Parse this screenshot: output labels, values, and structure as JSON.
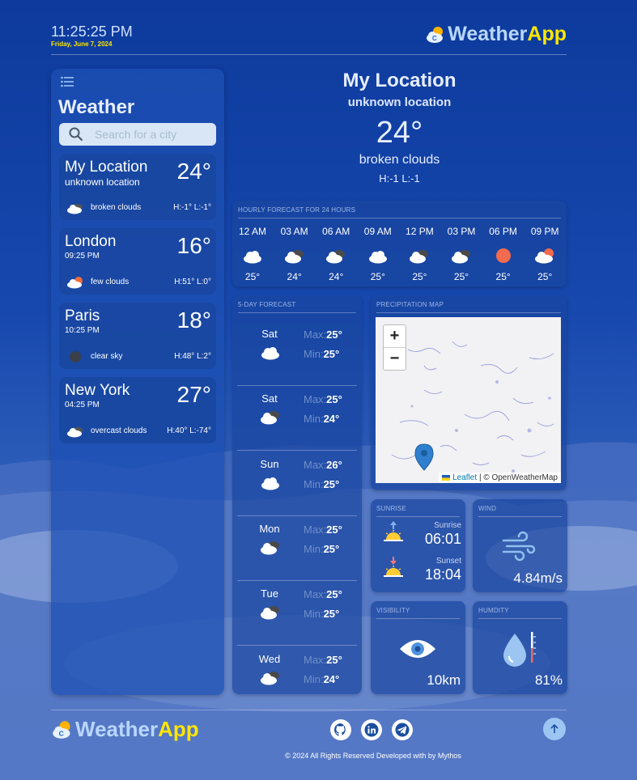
{
  "header": {
    "time": "11:25:25 PM",
    "date": "Friday, June 7, 2024",
    "logo_part1": "Weather",
    "logo_part2": "App"
  },
  "sidebar": {
    "title": "Weather",
    "search_placeholder": "Search for a city",
    "cities": [
      {
        "name": "My Location",
        "sub": "unknown location",
        "temp": "24°",
        "icon": "broken-clouds-icon",
        "condition": "broken clouds",
        "hl": "H:-1° L:-1°"
      },
      {
        "name": "London",
        "sub": "09:25 PM",
        "temp": "16°",
        "icon": "few-clouds-icon",
        "condition": "few clouds",
        "hl": "H:51° L:0°"
      },
      {
        "name": "Paris",
        "sub": "10:25 PM",
        "temp": "18°",
        "icon": "clear-sky-icon",
        "condition": "clear sky",
        "hl": "H:48° L:2°"
      },
      {
        "name": "New York",
        "sub": "04:25 PM",
        "temp": "27°",
        "icon": "overcast-clouds-icon",
        "condition": "overcast clouds",
        "hl": "H:40° L:-74°"
      }
    ]
  },
  "current": {
    "name": "My Location",
    "sub": "unknown location",
    "temp": "24°",
    "condition": "broken clouds",
    "hl": "H:-1 L:-1"
  },
  "hourly": {
    "title": "HOURLY FORECAST FOR 24 HOURS",
    "items": [
      {
        "time": "12 AM",
        "icon": "cloud-icon",
        "temp": "25°"
      },
      {
        "time": "03 AM",
        "icon": "broken-clouds-icon",
        "temp": "24°"
      },
      {
        "time": "06 AM",
        "icon": "broken-clouds-icon",
        "temp": "24°"
      },
      {
        "time": "09 AM",
        "icon": "cloud-icon",
        "temp": "25°"
      },
      {
        "time": "12 PM",
        "icon": "broken-clouds-icon",
        "temp": "25°"
      },
      {
        "time": "03 PM",
        "icon": "broken-clouds-icon",
        "temp": "25°"
      },
      {
        "time": "06 PM",
        "icon": "sun-icon",
        "temp": "25°"
      },
      {
        "time": "09 PM",
        "icon": "few-clouds-icon",
        "temp": "25°"
      }
    ]
  },
  "five_day": {
    "title": "5-DAY FORECAST",
    "max_label": "Max:",
    "min_label": "Min:",
    "days": [
      {
        "day": "Sat",
        "icon": "cloud-icon",
        "max": "25°",
        "min": "25°"
      },
      {
        "day": "Sat",
        "icon": "broken-clouds-icon",
        "max": "25°",
        "min": "24°"
      },
      {
        "day": "Sun",
        "icon": "cloud-icon",
        "max": "26°",
        "min": "25°"
      },
      {
        "day": "Mon",
        "icon": "broken-clouds-icon",
        "max": "25°",
        "min": "25°"
      },
      {
        "day": "Tue",
        "icon": "broken-clouds-icon",
        "max": "25°",
        "min": "25°"
      },
      {
        "day": "Wed",
        "icon": "broken-clouds-icon",
        "max": "25°",
        "min": "24°"
      }
    ]
  },
  "precipitation": {
    "title": "PRECIPITATION MAP",
    "zoom_in": "+",
    "zoom_out": "−",
    "attrib_leaflet": "Leaflet",
    "attrib_rest": "| © OpenWeatherMap"
  },
  "sunrise": {
    "title": "SUNRISE",
    "sunrise_label": "Sunrise",
    "sunrise_time": "06:01",
    "sunset_label": "Sunset",
    "sunset_time": "18:04"
  },
  "wind": {
    "title": "WIND",
    "value": "4.84m/s"
  },
  "visibility": {
    "title": "VISIBILITY",
    "value": "10km"
  },
  "humidity": {
    "title": "HUMDITY",
    "value": "81%"
  },
  "footer": {
    "logo_part1": "Weather",
    "logo_part2": "App",
    "copyright": "© 2024 All Rights Reserved Developed with by Mythos"
  }
}
